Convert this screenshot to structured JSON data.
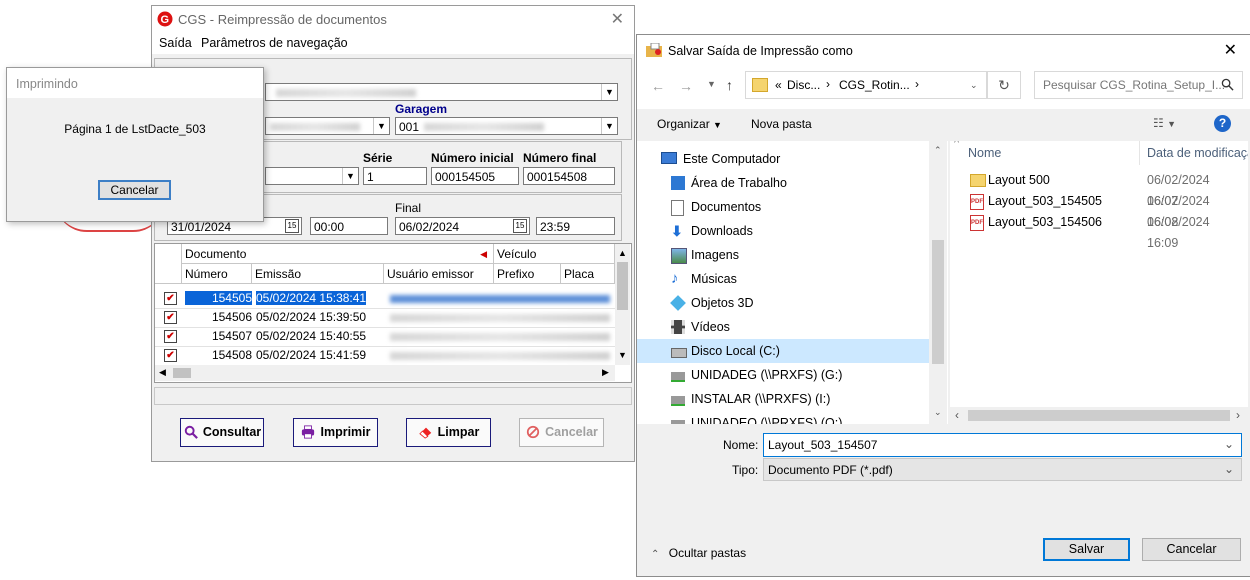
{
  "cgs_window": {
    "title": "CGS - Reimpressão de documentos",
    "menu": [
      "Saída",
      "Parâmetros de navegação"
    ],
    "garagem_label": "Garagem",
    "garagem_value": "001",
    "serie_label": "Série",
    "serie_value": "1",
    "numero_inicial_label": "Número inicial",
    "numero_inicial_value": "000154505",
    "numero_final_label": "Número final",
    "numero_final_value": "000154508",
    "data_inicial": "31/01/2024",
    "hora_inicial": "00:00",
    "final_label": "Final",
    "data_final": "06/02/2024",
    "hora_final": "23:59",
    "grid": {
      "group_headers": [
        "Documento",
        "Veículo"
      ],
      "columns": [
        "Número",
        "Emissão",
        "Usuário emissor",
        "Prefixo",
        "Placa"
      ],
      "rows": [
        {
          "numero": "154505",
          "emissao": "05/02/2024 15:38:41",
          "checked": "✔"
        },
        {
          "numero": "154506",
          "emissao": "05/02/2024 15:39:50",
          "checked": "✔"
        },
        {
          "numero": "154507",
          "emissao": "05/02/2024 15:40:55",
          "checked": "✔"
        },
        {
          "numero": "154508",
          "emissao": "05/02/2024 15:41:59",
          "checked": "✔"
        }
      ]
    },
    "buttons": {
      "consultar": "Consultar",
      "imprimir": "Imprimir",
      "limpar": "Limpar",
      "cancelar": "Cancelar"
    }
  },
  "printing_dialog": {
    "title": "Imprimindo",
    "message": "Página 1 de LstDacte_503",
    "cancel": "Cancelar"
  },
  "save_dialog": {
    "title": "Salvar Saída de Impressão como",
    "breadcrumb": [
      "«",
      "Disc...",
      "CGS_Rotin..."
    ],
    "search_placeholder": "Pesquisar CGS_Rotina_Setup_I...",
    "organize": "Organizar",
    "new_folder": "Nova pasta",
    "sidebar": [
      {
        "label": "Este Computador",
        "icon": "computer-icon"
      },
      {
        "label": "Área de Trabalho",
        "icon": "desktop-icon"
      },
      {
        "label": "Documentos",
        "icon": "documents-icon"
      },
      {
        "label": "Downloads",
        "icon": "download-icon"
      },
      {
        "label": "Imagens",
        "icon": "images-icon"
      },
      {
        "label": "Músicas",
        "icon": "music-icon"
      },
      {
        "label": "Objetos 3D",
        "icon": "3d-objects-icon"
      },
      {
        "label": "Vídeos",
        "icon": "videos-icon"
      },
      {
        "label": "Disco Local (C:)",
        "icon": "drive-icon",
        "selected": true
      },
      {
        "label": "UNIDADEG (\\\\PRXFS) (G:)",
        "icon": "network-drive-icon"
      },
      {
        "label": "INSTALAR (\\\\PRXFS) (I:)",
        "icon": "network-drive-icon"
      },
      {
        "label": "UNIDADEO (\\\\PRXFS) (O:)",
        "icon": "network-drive-icon"
      }
    ],
    "columns": {
      "name": "Nome",
      "modified": "Data de modificaçã"
    },
    "files": [
      {
        "name": "Layout 500",
        "date": "06/02/2024 16:07",
        "icon": "folder-icon"
      },
      {
        "name": "Layout_503_154505",
        "date": "06/02/2024 16:08",
        "icon": "pdf-icon"
      },
      {
        "name": "Layout_503_154506",
        "date": "06/02/2024 16:09",
        "icon": "pdf-icon"
      }
    ],
    "name_label": "Nome:",
    "name_value": "Layout_503_154507",
    "type_label": "Tipo:",
    "type_value": "Documento PDF (*.pdf)",
    "hide_folders": "Ocultar pastas",
    "save": "Salvar",
    "cancel": "Cancelar"
  }
}
